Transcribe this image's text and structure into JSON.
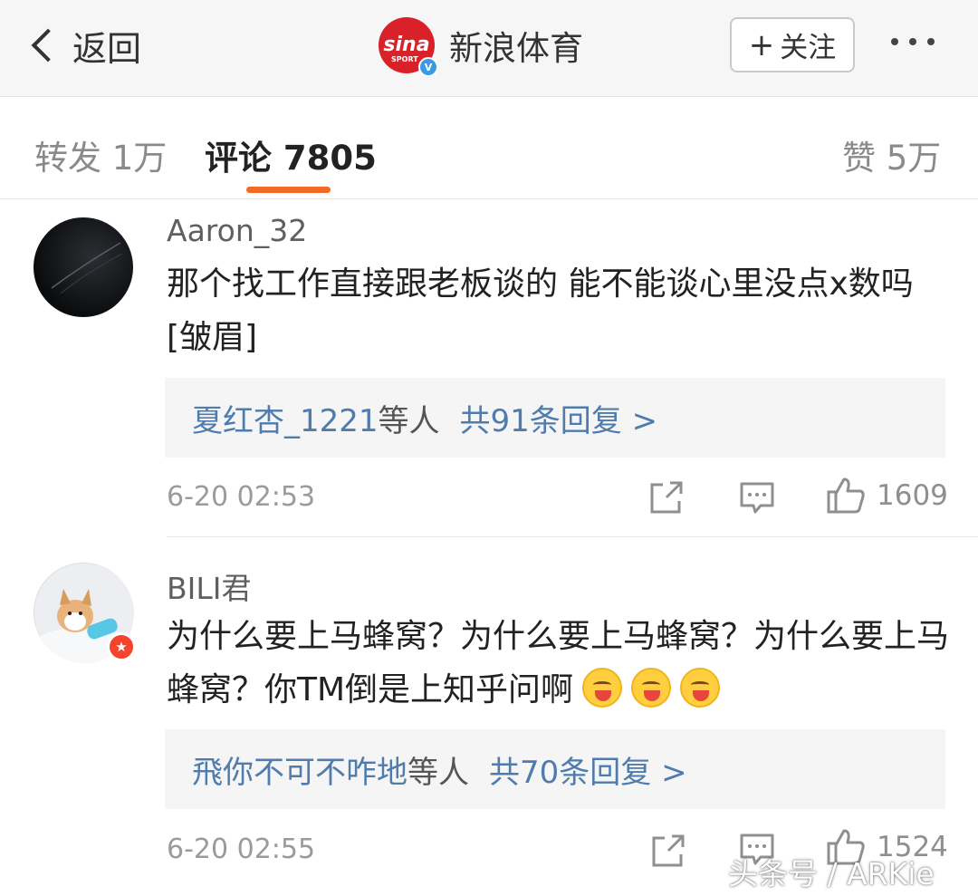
{
  "header": {
    "back_label": "返回",
    "account_name": "新浪体育",
    "logo_text": "sina",
    "logo_sub": "SPORT",
    "follow_label": "关注",
    "follow_plus": "+",
    "brand_color": "#d9212a",
    "verified_color": "#3b9ae1"
  },
  "tabs": {
    "forward": "转发 1万",
    "comments": "评论 7805",
    "likes": "赞 5万",
    "active_color": "#f26b24"
  },
  "comments": [
    {
      "username": "Aaron_32",
      "content": "那个找工作直接跟老板谈的 能不能谈心里没点x数吗[皱眉]",
      "reply_users": "夏红杏_1221",
      "reply_etc": "等人",
      "reply_count": "共91条回复 >",
      "time": "6-20 02:53",
      "likes": "1609"
    },
    {
      "username": "BILI君",
      "content": "为什么要上马蜂窝？为什么要上马蜂窝？为什么要上马蜂窝？你TM倒是上知乎问啊",
      "emoji_count": 3,
      "reply_users": "飛你不可不咋地",
      "reply_etc": "等人",
      "reply_count": "共70条回复 >",
      "time": "6-20 02:55",
      "likes": "1524"
    }
  ],
  "link_color": "#4f7cad",
  "watermark": "头条号 / ARKie"
}
